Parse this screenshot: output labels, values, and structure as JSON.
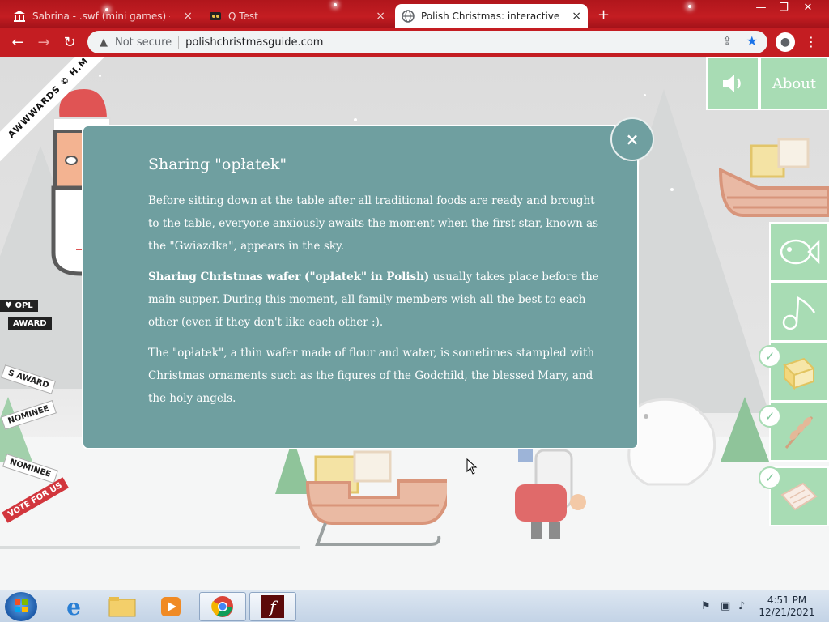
{
  "browser": {
    "tabs": [
      {
        "label": "Sabrina - .swf (mini games) - Free ...",
        "active": false
      },
      {
        "label": "Q Test",
        "active": false
      },
      {
        "label": "Polish Christmas: interactive",
        "active": true
      }
    ],
    "new_tab_symbol": "+",
    "close_symbol": "×",
    "address": {
      "security_label": "Not secure",
      "url": "polishchristmasguide.com"
    },
    "window_controls": [
      "—",
      "❐",
      "✕"
    ]
  },
  "page": {
    "awwwards_ribbon": "AWWWARDS © H.M",
    "badges": {
      "opl": "♥ OPL",
      "award": "AWARD",
      "s_award": "S AWARD",
      "nominee_1": "NOMINEE",
      "nominee_2": "NOMINEE",
      "vote": "VOTE FOR US"
    },
    "about_label": "About",
    "sound_icon": "speaker-icon",
    "side_buttons": [
      {
        "icon": "fish-icon",
        "checked": false
      },
      {
        "icon": "music-note-icon",
        "checked": false
      },
      {
        "icon": "gift-box-icon",
        "checked": true
      },
      {
        "icon": "wheat-icon",
        "checked": true
      },
      {
        "icon": "wafer-icon",
        "checked": true
      }
    ],
    "modal": {
      "title": "Sharing \"opłatek\"",
      "close_symbol": "×",
      "paragraph_1": "Before sitting down at the table after all traditional foods are ready and brought to the table, everyone anxiously awaits the moment when the first star, known as the \"Gwiazdka\", appears in the sky.",
      "paragraph_2_bold": "Sharing Christmas wafer (\"opłatek\" in Polish)",
      "paragraph_2_rest": " usually takes place before the main supper. During this moment, all family members wish all the best to each other (even if they don't like each other :).",
      "paragraph_3": "The \"opłatek\", a thin wafer made of flour and water, is sometimes stampled with Christmas ornaments such as the figures of the Godchild, the blessed Mary, and the holy angels."
    }
  },
  "taskbar": {
    "apps": [
      {
        "name": "internet-explorer"
      },
      {
        "name": "file-explorer"
      },
      {
        "name": "media-player"
      },
      {
        "name": "chrome"
      },
      {
        "name": "flash-player"
      }
    ],
    "clock_time": "4:51 PM",
    "clock_date": "12/21/2021"
  },
  "colors": {
    "chrome_red": "#c41d22",
    "modal_bg": "#6f9fa0",
    "mint": "#a8dcb4"
  }
}
